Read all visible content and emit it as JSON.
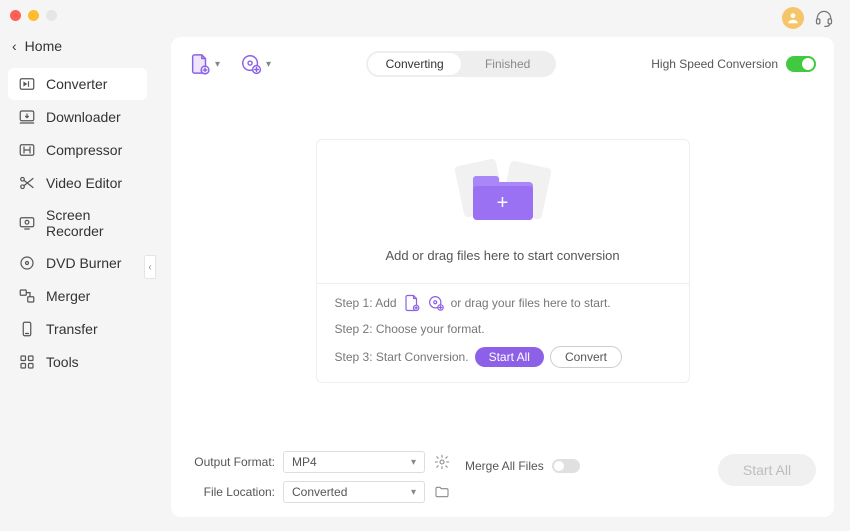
{
  "window": {
    "traffic": [
      "#ff5f57",
      "#febc2e",
      "#e6e6e6"
    ]
  },
  "home": {
    "label": "Home"
  },
  "sidebar": {
    "items": [
      {
        "label": "Converter"
      },
      {
        "label": "Downloader"
      },
      {
        "label": "Compressor"
      },
      {
        "label": "Video Editor"
      },
      {
        "label": "Screen Recorder"
      },
      {
        "label": "DVD Burner"
      },
      {
        "label": "Merger"
      },
      {
        "label": "Transfer"
      },
      {
        "label": "Tools"
      }
    ]
  },
  "segmented": {
    "converting": "Converting",
    "finished": "Finished"
  },
  "highspeed": {
    "label": "High Speed Conversion"
  },
  "drop": {
    "main_text": "Add or drag files here to start conversion",
    "step1_pre": "Step 1: Add",
    "step1_post": "or drag your files here to start.",
    "step2": "Step 2: Choose your format.",
    "step3_pre": "Step 3: Start Conversion.",
    "start_all": "Start  All",
    "convert": "Convert"
  },
  "footer": {
    "output_label": "Output Format:",
    "output_value": "MP4",
    "location_label": "File Location:",
    "location_value": "Converted",
    "merge_label": "Merge All Files",
    "start_all": "Start All"
  }
}
